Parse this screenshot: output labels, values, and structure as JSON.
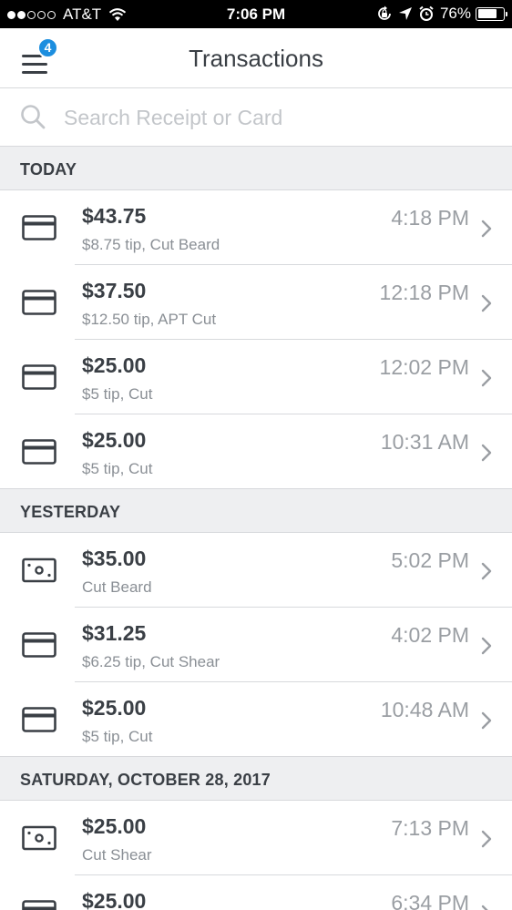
{
  "status_bar": {
    "carrier": "AT&T",
    "time": "7:06 PM",
    "battery": "76%",
    "battery_level": 0.76,
    "signal_bars_filled": 2,
    "signal_bars_total": 5
  },
  "header": {
    "title": "Transactions",
    "menu_badge": "4"
  },
  "search": {
    "placeholder": "Search Receipt or Card"
  },
  "colors": {
    "accent": "#1c8edf",
    "section_bg": "#eeeff1",
    "text": "#3a3f45",
    "muted": "#8a8f95"
  },
  "sections": [
    {
      "title": "TODAY",
      "items": [
        {
          "icon": "card-icon",
          "amount": "$43.75",
          "detail": "$8.75 tip, Cut Beard",
          "time": "4:18 PM"
        },
        {
          "icon": "card-icon",
          "amount": "$37.50",
          "detail": "$12.50 tip, APT Cut",
          "time": "12:18 PM"
        },
        {
          "icon": "card-icon",
          "amount": "$25.00",
          "detail": "$5 tip, Cut",
          "time": "12:02 PM"
        },
        {
          "icon": "card-icon",
          "amount": "$25.00",
          "detail": "$5 tip, Cut",
          "time": "10:31 AM"
        }
      ]
    },
    {
      "title": "YESTERDAY",
      "items": [
        {
          "icon": "cash-icon",
          "amount": "$35.00",
          "detail": "Cut Beard",
          "time": "5:02 PM"
        },
        {
          "icon": "card-icon",
          "amount": "$31.25",
          "detail": "$6.25 tip, Cut Shear",
          "time": "4:02 PM"
        },
        {
          "icon": "card-icon",
          "amount": "$25.00",
          "detail": "$5 tip, Cut",
          "time": "10:48 AM"
        }
      ]
    },
    {
      "title": "SATURDAY, OCTOBER 28, 2017",
      "items": [
        {
          "icon": "cash-icon",
          "amount": "$25.00",
          "detail": "Cut Shear",
          "time": "7:13 PM"
        },
        {
          "icon": "card-icon",
          "amount": "$25.00",
          "detail": "",
          "time": "6:34 PM"
        }
      ]
    }
  ]
}
